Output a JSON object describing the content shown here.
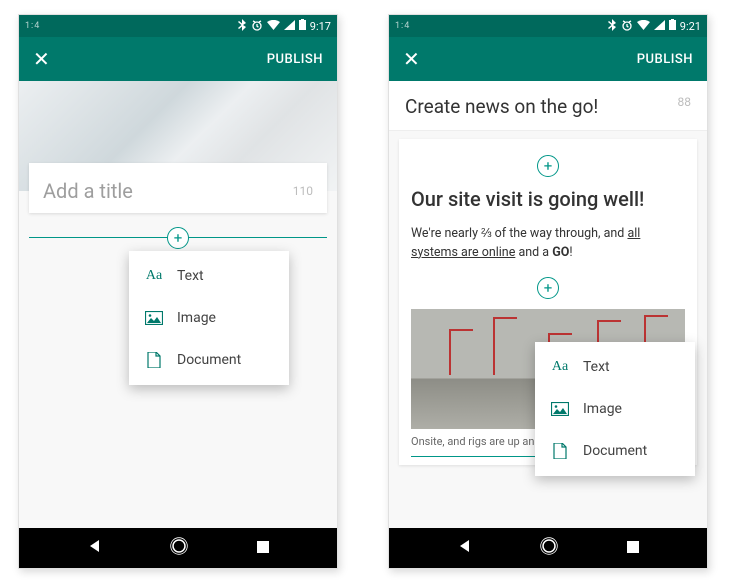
{
  "left": {
    "status": {
      "carrier": "1:4",
      "time": "9:17"
    },
    "appbar": {
      "publish": "PUBLISH"
    },
    "title": {
      "placeholder": "Add a title",
      "count": "110"
    },
    "menu": {
      "text": "Text",
      "image": "Image",
      "document": "Document"
    }
  },
  "right": {
    "status": {
      "carrier": "1:4",
      "time": "9:21"
    },
    "appbar": {
      "publish": "PUBLISH"
    },
    "header": {
      "title": "Create news on the go!",
      "count": "88"
    },
    "body": {
      "heading": "Our site visit is going well!",
      "para_pre": "We're nearly ⅔ of the way through, and ",
      "para_underline": "all systems are online",
      "para_mid": " and a ",
      "para_bold": "GO",
      "para_end": "!",
      "caption": "Onsite, and rigs are up and running"
    },
    "menu": {
      "text": "Text",
      "image": "Image",
      "document": "Document"
    }
  }
}
